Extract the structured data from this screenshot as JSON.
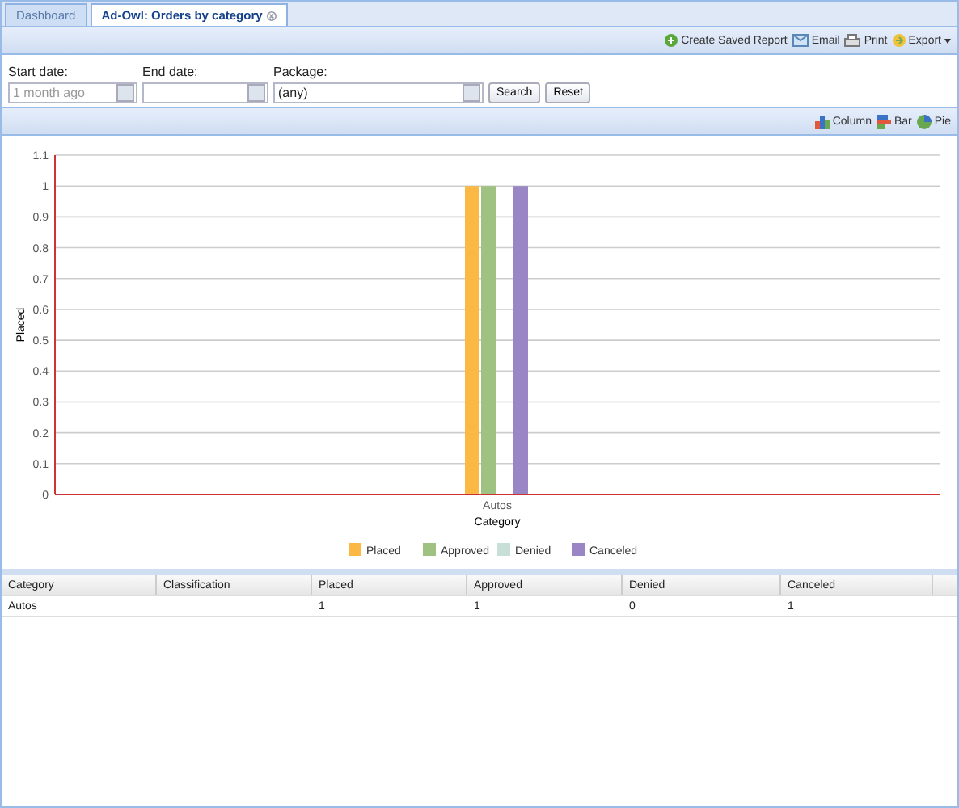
{
  "tabs": [
    {
      "label": "Dashboard",
      "selected": false,
      "closable": false
    },
    {
      "label": "Ad-Owl: Orders by category",
      "selected": true,
      "closable": true
    }
  ],
  "toolbar": {
    "actions": [
      {
        "label": "Create Saved Report",
        "kind": "add"
      },
      {
        "label": "Email",
        "kind": "email"
      },
      {
        "label": "Print",
        "kind": "print"
      },
      {
        "label": "Export",
        "kind": "export"
      }
    ]
  },
  "filters": {
    "start_date": {
      "label": "Start date:",
      "placeholder": "1 month ago"
    },
    "end_date": {
      "label": "End date:"
    },
    "package": {
      "label": "Package:",
      "value": "(any)"
    },
    "buttons": [
      "Search",
      "Reset"
    ]
  },
  "chart_types": [
    {
      "label": "Column",
      "kind": "column"
    },
    {
      "label": "Bar",
      "kind": "bar"
    },
    {
      "label": "Pie",
      "kind": "pie"
    }
  ],
  "chart": {
    "chart_data": {
      "type": "bar",
      "xlabel": "Category",
      "ylabel": "Placed",
      "categories": [
        "Autos"
      ],
      "series": [
        {
          "name": "Placed",
          "color": "#fbb845",
          "values": [
            1
          ]
        },
        {
          "name": "Approved",
          "color": "#9fc283",
          "values": [
            1
          ]
        },
        {
          "name": "Denied",
          "color": "#c8dfd7",
          "values": [
            0
          ]
        },
        {
          "name": "Canceled",
          "color": "#9a86c4",
          "values": [
            1
          ]
        }
      ],
      "ylim": [
        0,
        1.1
      ],
      "grid": true,
      "legend": true,
      "yticks": [
        0,
        0.1,
        0.2,
        0.3,
        0.4,
        0.5,
        0.6,
        0.7,
        0.8,
        0.9,
        1,
        1.1
      ]
    }
  },
  "table": {
    "columns": [
      "Category",
      "Classification",
      "Placed",
      "Approved",
      "Denied",
      "Canceled"
    ],
    "rows": [
      [
        "Autos",
        "",
        "1",
        "1",
        "0",
        "1"
      ]
    ]
  }
}
